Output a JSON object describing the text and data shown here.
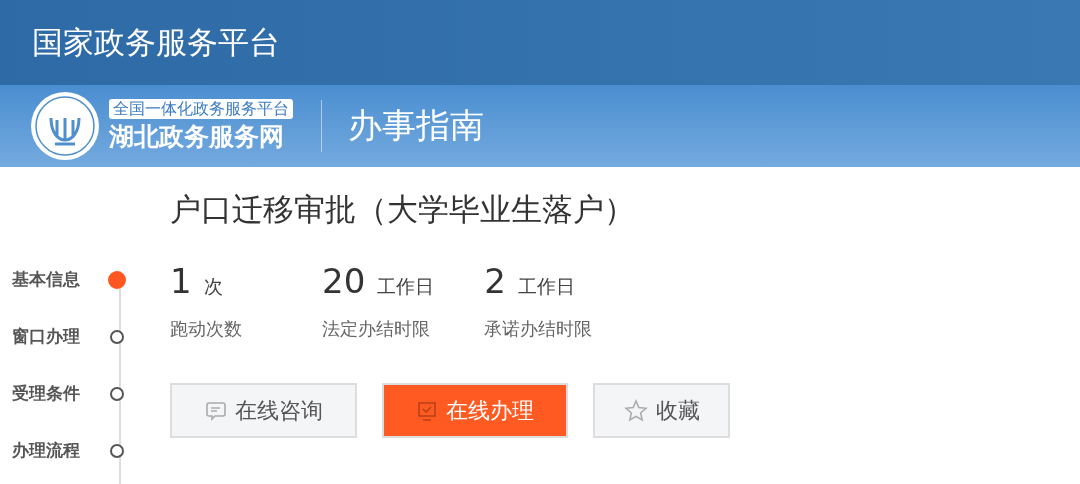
{
  "top_bar": {
    "title": "国家政务服务平台"
  },
  "site_header": {
    "badge": "全国一体化政务服务平台",
    "site_name": "湖北政务服务网",
    "section": "办事指南"
  },
  "nav": [
    {
      "label": "基本信息",
      "selected": true
    },
    {
      "label": "窗口办理",
      "selected": false
    },
    {
      "label": "受理条件",
      "selected": false
    },
    {
      "label": "办理流程",
      "selected": false
    }
  ],
  "title": "户口迁移审批（大学毕业生落户）",
  "stats": [
    {
      "value": "1",
      "unit": "次",
      "label": "跑动次数"
    },
    {
      "value": "20",
      "unit": "工作日",
      "label": "法定办结时限"
    },
    {
      "value": "2",
      "unit": "工作日",
      "label": "承诺办结时限"
    }
  ],
  "buttons": [
    {
      "label": "在线咨询",
      "kind": "chat"
    },
    {
      "label": "在线办理",
      "kind": "apply"
    },
    {
      "label": "收藏",
      "kind": "star"
    }
  ]
}
